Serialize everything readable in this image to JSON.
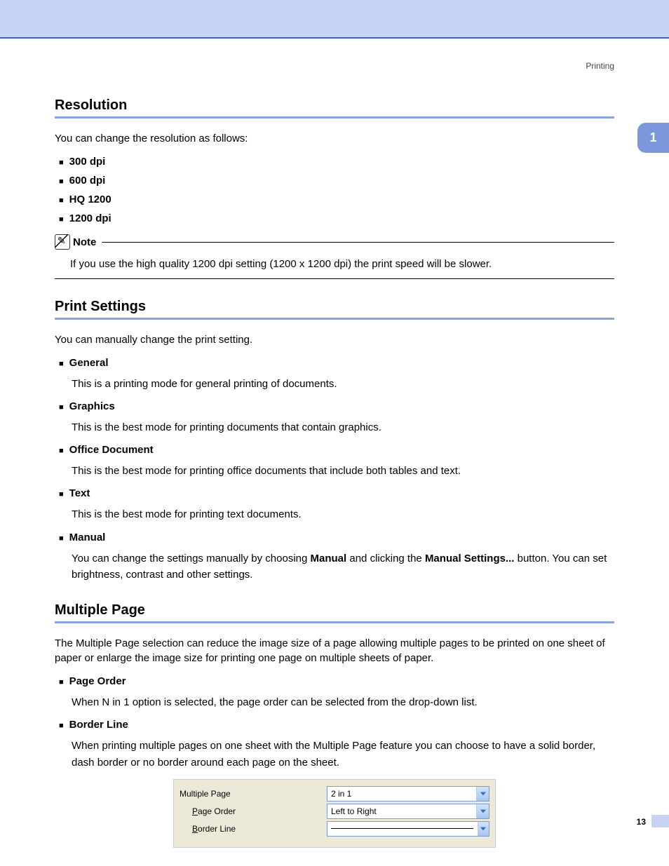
{
  "header": {
    "section_label": "Printing"
  },
  "chapter_tab": "1",
  "page_number": "13",
  "resolution": {
    "heading": "Resolution",
    "intro": "You can change the resolution as follows:",
    "items": [
      "300 dpi",
      "600 dpi",
      "HQ 1200",
      "1200 dpi"
    ],
    "note_label": "Note",
    "note_text": "If you use the high quality 1200 dpi setting (1200 x 1200 dpi) the print speed will be slower."
  },
  "print_settings": {
    "heading": "Print Settings",
    "intro": "You can manually change the print setting.",
    "items": [
      {
        "label": "General",
        "desc": "This is a printing mode for general printing of documents."
      },
      {
        "label": "Graphics",
        "desc": "This is the best mode for printing documents that contain graphics."
      },
      {
        "label": "Office Document",
        "desc": "This is the best mode for printing office documents that include both tables and text."
      },
      {
        "label": "Text",
        "desc": "This is the best mode for printing text documents."
      },
      {
        "label": "Manual",
        "desc_pre": "You can change the settings manually by choosing ",
        "desc_b1": "Manual",
        "desc_mid": " and clicking the ",
        "desc_b2": "Manual Settings...",
        "desc_post": " button. You can set brightness, contrast and other settings."
      }
    ]
  },
  "multiple_page": {
    "heading": "Multiple Page",
    "intro": "The Multiple Page selection can reduce the image size of a page allowing multiple pages to be printed on one sheet of paper or enlarge the image size for printing one page on multiple sheets of paper.",
    "items": [
      {
        "label": "Page Order",
        "desc": "When N in 1 option is selected, the page order can be selected from the drop-down list."
      },
      {
        "label": "Border Line",
        "desc": "When printing multiple pages on one sheet with the Multiple Page feature you can choose to have a solid border, dash border or no border around each page on the sheet."
      }
    ]
  },
  "settings_panel": {
    "rows": [
      {
        "label_pre": "",
        "label_u": "",
        "label_post": "Multiple Page",
        "value": "2 in 1",
        "indent": false
      },
      {
        "label_pre": "",
        "label_u": "P",
        "label_post": "age Order",
        "value": "Left to Right",
        "indent": true
      },
      {
        "label_pre": "",
        "label_u": "B",
        "label_post": "order Line",
        "value": "",
        "indent": true,
        "line": true
      }
    ]
  }
}
